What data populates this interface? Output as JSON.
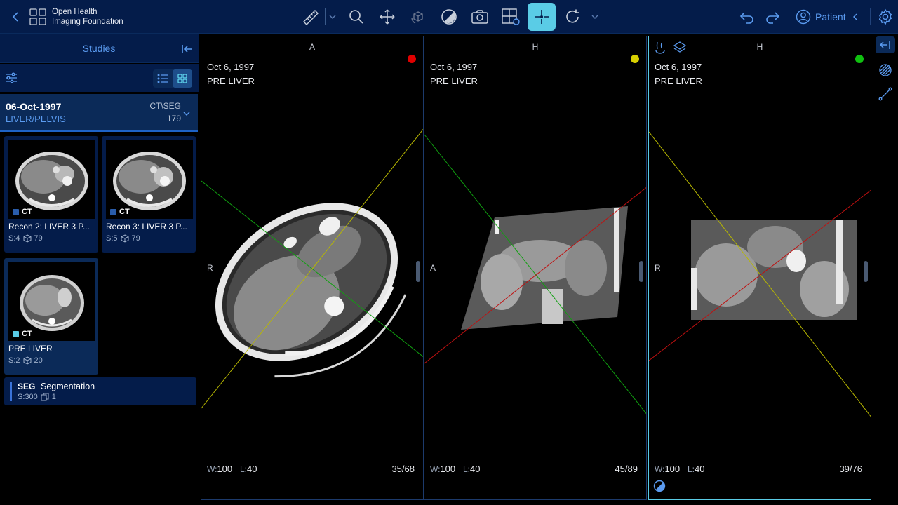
{
  "header": {
    "logo_line1": "Open Health",
    "logo_line2": "Imaging Foundation",
    "tools": [
      {
        "icon": "measure-ruler-icon"
      },
      {
        "icon": "zoom-icon"
      },
      {
        "icon": "pan-icon"
      },
      {
        "icon": "3d-rotate-icon"
      },
      {
        "icon": "window-level-icon"
      },
      {
        "icon": "capture-icon"
      },
      {
        "icon": "layout-icon"
      },
      {
        "icon": "crosshairs-icon",
        "active": true
      },
      {
        "icon": "reset-icon"
      }
    ],
    "patient_label": "Patient"
  },
  "studies": {
    "title": "Studies",
    "study": {
      "date": "06-Oct-1997",
      "description": "LIVER/PELVIS",
      "modality": "CT\\SEG",
      "instances": "179"
    },
    "series": [
      {
        "modality": "CT",
        "title": "Recon 2: LIVER 3 P...",
        "series_num": "S:4",
        "instances": "79",
        "color": "#2a5dab"
      },
      {
        "modality": "CT",
        "title": "Recon 3: LIVER 3 P...",
        "series_num": "S:5",
        "instances": "79",
        "color": "#2a5dab"
      },
      {
        "modality": "CT",
        "title": "PRE LIVER",
        "series_num": "S:2",
        "instances": "20",
        "color": "#5acce6"
      }
    ],
    "seg": {
      "modality": "SEG",
      "title": "Segmentation",
      "series_num": "S:300",
      "instances": "1"
    }
  },
  "viewports": [
    {
      "orient_top": "A",
      "orient_left": "R",
      "date": "Oct 6, 1997",
      "series": "PRE LIVER",
      "w_label": "W:",
      "w": "100",
      "l_label": "L:",
      "l": "40",
      "slice": "35/68",
      "dot_color": "#e00000"
    },
    {
      "orient_top": "H",
      "orient_left": "A",
      "date": "Oct 6, 1997",
      "series": "PRE LIVER",
      "w_label": "W:",
      "w": "100",
      "l_label": "L:",
      "l": "40",
      "slice": "45/89",
      "dot_color": "#d8d000"
    },
    {
      "orient_top": "H",
      "orient_left": "R",
      "date": "Oct 6, 1997",
      "series": "PRE LIVER",
      "w_label": "W:",
      "w": "100",
      "l_label": "L:",
      "l": "40",
      "slice": "39/76",
      "dot_color": "#10c010"
    }
  ],
  "colors": {
    "accent": "#5acce6",
    "primary": "#5b9bf0",
    "header_bg": "#041c4a"
  }
}
